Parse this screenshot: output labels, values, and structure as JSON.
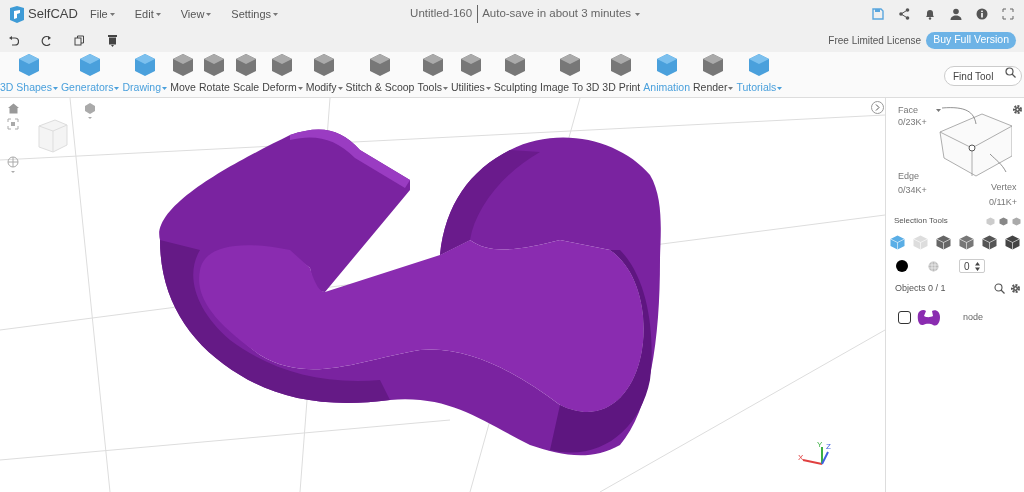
{
  "app": {
    "name": "SelfCAD"
  },
  "menu": [
    {
      "label": "File"
    },
    {
      "label": "Edit"
    },
    {
      "label": "View"
    },
    {
      "label": "Settings"
    }
  ],
  "document": {
    "title": "Untitled-160",
    "autosave": "Auto-save in about 3 minutes"
  },
  "license": {
    "text": "Free Limited License",
    "button": "Buy Full Version"
  },
  "tools": [
    {
      "label": "3D Shapes",
      "accent": true,
      "dropdown": true
    },
    {
      "label": "Generators",
      "accent": true,
      "dropdown": true
    },
    {
      "label": "Drawing",
      "accent": true,
      "dropdown": true
    },
    {
      "label": "Move",
      "accent": false,
      "dropdown": false
    },
    {
      "label": "Rotate",
      "accent": false,
      "dropdown": false
    },
    {
      "label": "Scale",
      "accent": false,
      "dropdown": false
    },
    {
      "label": "Deform",
      "accent": false,
      "dropdown": true
    },
    {
      "label": "Modify",
      "accent": false,
      "dropdown": true
    },
    {
      "label": "Stitch & Scoop",
      "accent": false,
      "dropdown": false
    },
    {
      "label": "Tools",
      "accent": false,
      "dropdown": true
    },
    {
      "label": "Utilities",
      "accent": false,
      "dropdown": true
    },
    {
      "label": "Sculpting",
      "accent": false,
      "dropdown": false
    },
    {
      "label": "Image To 3D",
      "accent": false,
      "dropdown": false
    },
    {
      "label": "3D Print",
      "accent": false,
      "dropdown": false
    },
    {
      "label": "Animation",
      "accent": true,
      "dropdown": false
    },
    {
      "label": "Render",
      "accent": false,
      "dropdown": true
    },
    {
      "label": "Tutorials",
      "accent": true,
      "dropdown": true
    }
  ],
  "find_tool": {
    "placeholder": "Find Tool"
  },
  "viewport": {
    "axes": [
      "X",
      "Y",
      "Z"
    ]
  },
  "panel": {
    "face": {
      "label": "Face",
      "count": "0/23K+"
    },
    "edge": {
      "label": "Edge",
      "count": "0/34K+"
    },
    "vertex": {
      "label": "Vertex",
      "count": "0/11K+"
    },
    "selection_tools": "Selection Tools",
    "number": "0",
    "objects": "Objects 0 / 1",
    "items": [
      {
        "name": "node",
        "checked": false
      }
    ]
  }
}
